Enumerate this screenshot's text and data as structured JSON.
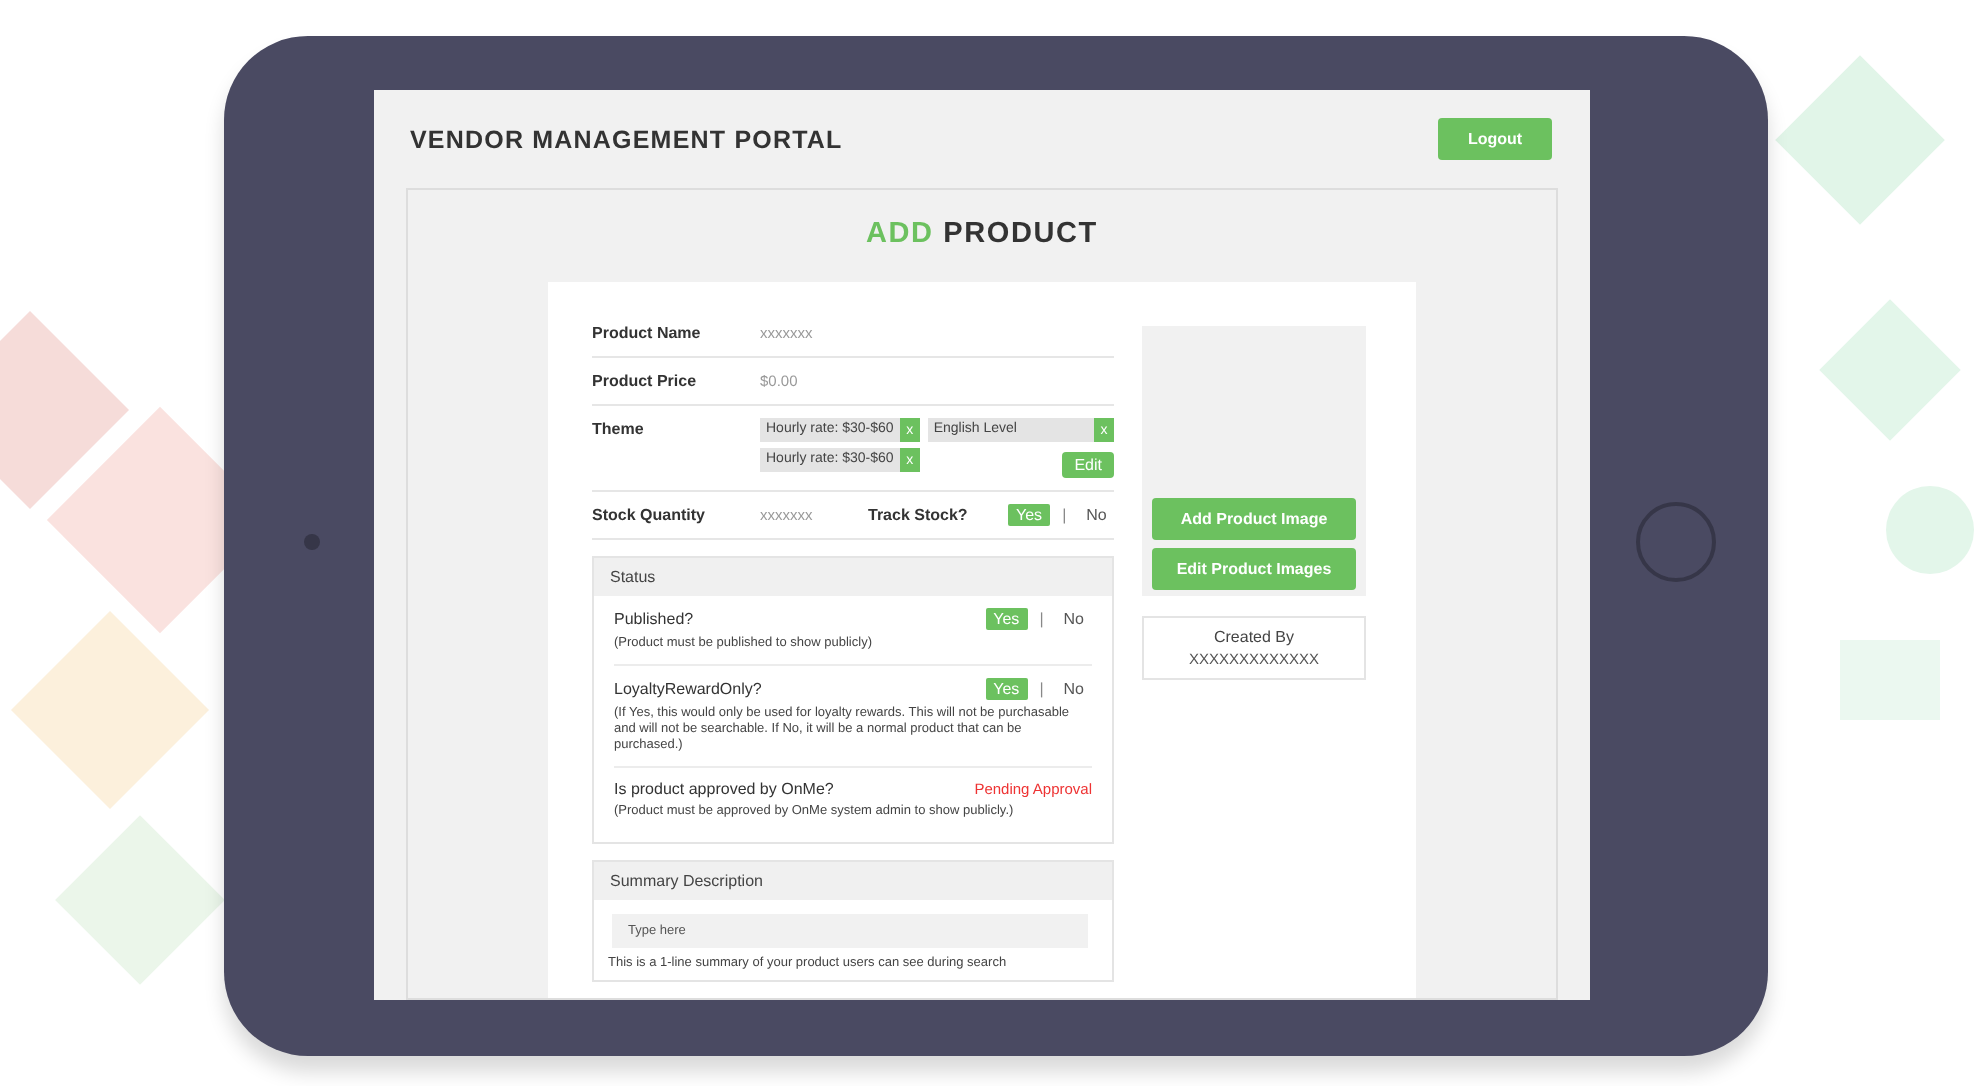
{
  "header": {
    "title": "VENDOR MANAGEMENT PORTAL",
    "logout": "Logout"
  },
  "page_title": {
    "accent": "ADD",
    "rest": "PRODUCT"
  },
  "fields": [
    {
      "kind": "text",
      "label": "Product Name",
      "placeholder": "xxxxxxx"
    },
    {
      "kind": "text",
      "label": "Product Price",
      "placeholder": "$0.00"
    },
    {
      "kind": "tags",
      "label": "Theme",
      "tags": [
        {
          "text": "Hourly rate: $30-$60",
          "remove": "x"
        },
        {
          "text": "English Level",
          "remove": "x"
        },
        {
          "text": "Hourly rate: $30-$60",
          "remove": "x"
        }
      ],
      "edit": "Edit"
    },
    {
      "kind": "stock",
      "label": "Stock Quantity",
      "placeholder": "xxxxxxx",
      "toggle_label": "Track Stock?",
      "options": [
        {
          "label": "Yes",
          "selected": true
        },
        {
          "label": "No",
          "selected": false
        }
      ],
      "separator": "|"
    }
  ],
  "status": {
    "title": "Status",
    "items": [
      {
        "kind": "toggle",
        "question": "Published?",
        "note": "(Product must be published to show publicly)",
        "options": [
          {
            "label": "Yes",
            "selected": true
          },
          {
            "label": "No",
            "selected": false
          }
        ],
        "separator": "|"
      },
      {
        "kind": "toggle",
        "question": "LoyaltyRewardOnly?",
        "note": "(If Yes,  this would only be used for loyalty rewards. This will not be purchasable and will not be searchable. If No, it will be a normal product that can be purchased.)",
        "options": [
          {
            "label": "Yes",
            "selected": true
          },
          {
            "label": "No",
            "selected": false
          }
        ],
        "separator": "|"
      },
      {
        "kind": "state",
        "question": "Is product approved by OnMe?",
        "state": "Pending Approval",
        "note": "(Product must be approved by OnMe system admin to show publicly.)"
      }
    ]
  },
  "summary": {
    "title": "Summary Description",
    "placeholder": "Type here",
    "hint": "This is a 1-line summary of your product users can see during search"
  },
  "image_panel": {
    "add": "Add Product Image",
    "edit": "Edit Product Images"
  },
  "created_by": {
    "label": "Created By",
    "value": "XXXXXXXXXXXXX"
  }
}
